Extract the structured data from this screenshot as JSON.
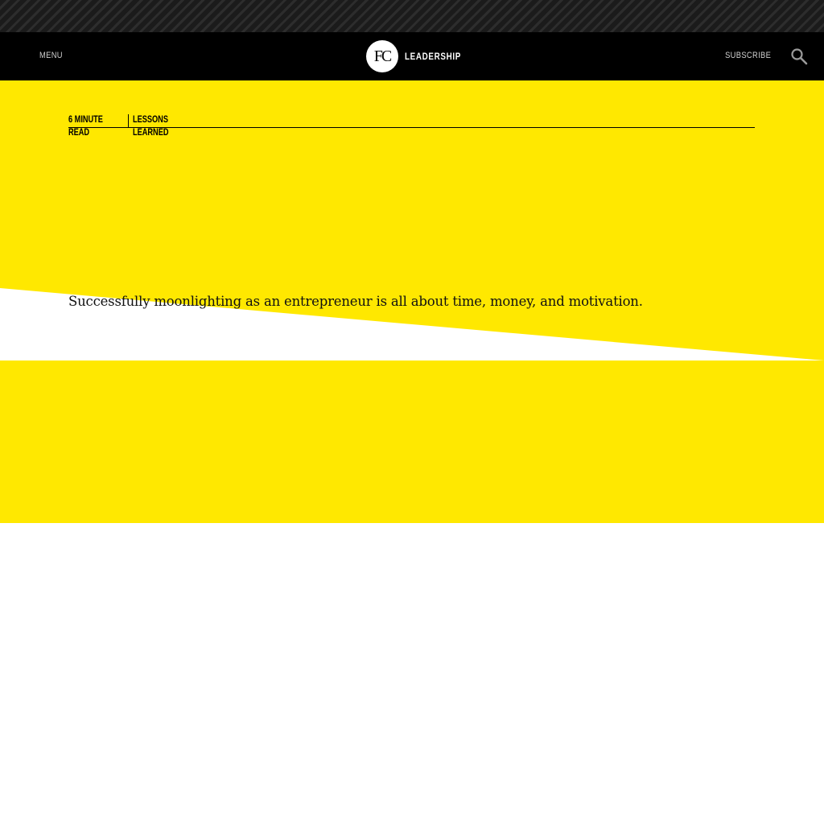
{
  "header": {
    "menu_label": "MENU",
    "logo_text": "FC",
    "section_label": "LEADERSHIP",
    "subscribe_label": "SUBSCRIBE",
    "search_icon": "search-icon"
  },
  "article": {
    "read_time": "6 MINUTE READ",
    "category": "LESSONS LEARNED",
    "dek": "Successfully moonlighting as an entrepreneur is all about time, money, and motivation."
  },
  "colors": {
    "hero_yellow": "#ffe800",
    "nav_black": "#000000",
    "stripe_dark": "#1b1b1b"
  }
}
